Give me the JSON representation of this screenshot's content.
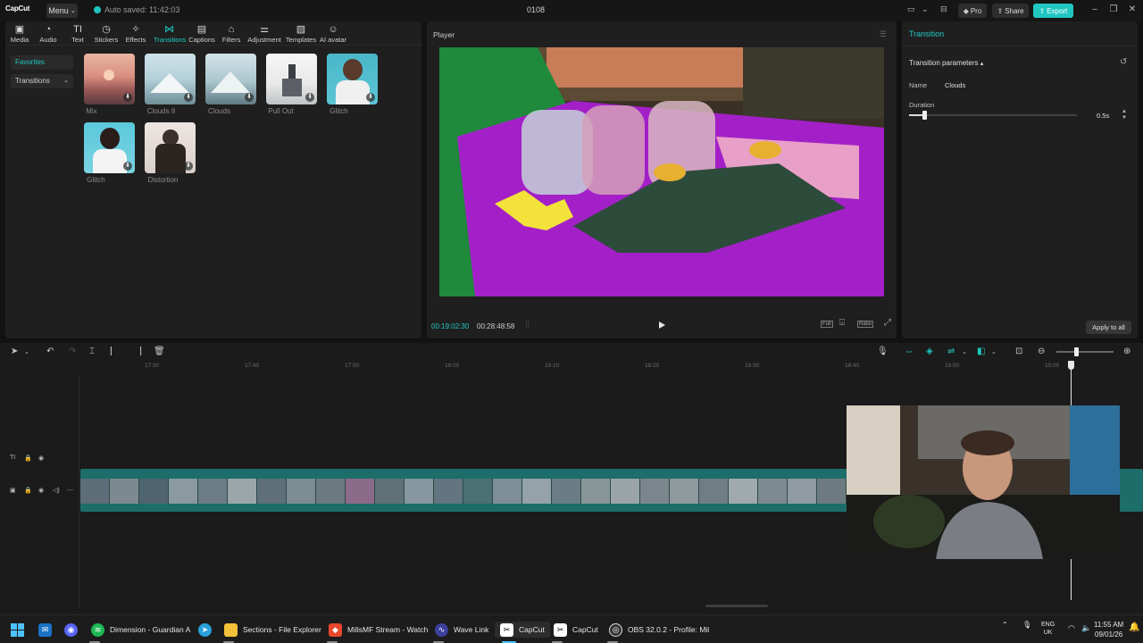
{
  "titlebar": {
    "logo": "CapCut",
    "menu_label": "Menu",
    "autosave_text": "Auto saved: 11:42:03",
    "project_name": "0108",
    "pro_label": "Pro",
    "share_label": "Share",
    "export_label": "Export"
  },
  "toolbar": [
    {
      "label": "Media",
      "icon": "media-icon"
    },
    {
      "label": "Audio",
      "icon": "audio-icon"
    },
    {
      "label": "Text",
      "icon": "text-icon"
    },
    {
      "label": "Stickers",
      "icon": "stickers-icon"
    },
    {
      "label": "Effects",
      "icon": "effects-icon"
    },
    {
      "label": "Transitions",
      "icon": "transitions-icon",
      "active": true
    },
    {
      "label": "Captions",
      "icon": "captions-icon"
    },
    {
      "label": "Filters",
      "icon": "filters-icon"
    },
    {
      "label": "Adjustment",
      "icon": "adjustment-icon"
    },
    {
      "label": "Templates",
      "icon": "templates-icon"
    },
    {
      "label": "AI avatar",
      "icon": "ai-avatar-icon"
    }
  ],
  "sidebar": {
    "favorites": "Favorites",
    "transitions": "Transitions"
  },
  "transitions": [
    {
      "label": "Mix"
    },
    {
      "label": "Clouds II"
    },
    {
      "label": "Clouds"
    },
    {
      "label": "Pull Out"
    },
    {
      "label": "Glitch"
    },
    {
      "label": "Glitch"
    },
    {
      "label": "Distortion"
    }
  ],
  "player": {
    "title": "Player",
    "time_current": "00:19:02:30",
    "time_total": "00:28:48:58",
    "full_label": "Full",
    "ratio_label": "Ratio"
  },
  "inspector": {
    "title": "Transition",
    "params_title": "Transition parameters",
    "name_label": "Name",
    "name_value": "Clouds",
    "duration_label": "Duration",
    "duration_value": "0.5s",
    "duration_fraction": 0.09,
    "apply_label": "Apply to all"
  },
  "timeline": {
    "ruler_labels": [
      "17:30",
      "17:40",
      "17:50",
      "18:00",
      "18:10",
      "18:20",
      "18:30",
      "18:40",
      "18:50",
      "19:00"
    ],
    "zoom_fraction": 0.35
  },
  "taskbar": {
    "items": [
      {
        "label": "Dimension - Guardian A",
        "icon": "spotify-icon",
        "color": "#1db954"
      },
      {
        "label": "Sections - File Explorer",
        "icon": "folder-icon",
        "color": "#f3c23a"
      },
      {
        "label": "MillsMF Stream - Watch",
        "icon": "brave-icon",
        "color": "#e8472b"
      },
      {
        "label": "Wave Link",
        "icon": "wave-link-icon",
        "color": "#3b3f9e"
      },
      {
        "label": "CapCut",
        "icon": "capcut-icon",
        "color": "#2a2a2a"
      },
      {
        "label": "CapCut",
        "icon": "capcut-icon",
        "color": "#2a2a2a"
      },
      {
        "label": "OBS 32.0.2 - Profile: Mil",
        "icon": "obs-icon",
        "color": "#333"
      }
    ],
    "lang_1": "ENG",
    "lang_2": "UK",
    "time": "11:55 AM",
    "date": "09/01/26"
  }
}
